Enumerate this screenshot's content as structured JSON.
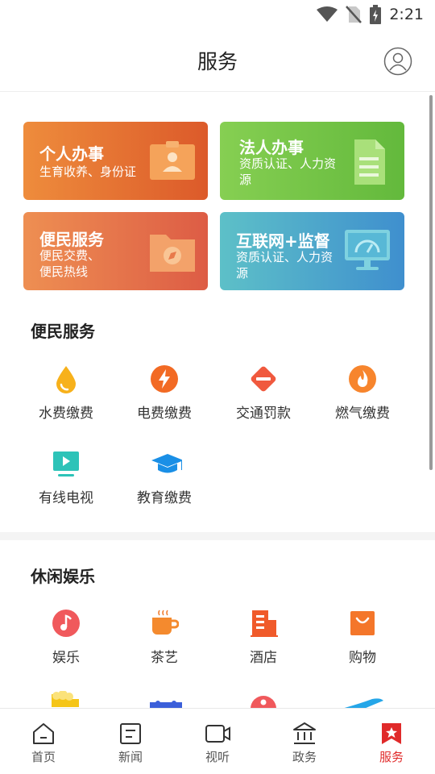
{
  "status_bar": {
    "time": "2:21"
  },
  "header": {
    "title": "服务"
  },
  "cards": [
    {
      "title": "个人办事",
      "subtitle": "生育收养、身份证",
      "icon": "id-card-icon"
    },
    {
      "title": "法人办事",
      "subtitle": "资质认证、人力资源",
      "icon": "document-icon"
    },
    {
      "title": "便民服务",
      "subtitle": "便民交费、便民热线",
      "icon": "folder-compass-icon"
    },
    {
      "title": "互联网+监督",
      "subtitle": "资质认证、人力资源",
      "icon": "monitor-icon"
    }
  ],
  "convenience": {
    "title": "便民服务",
    "items": [
      {
        "label": "水费缴费",
        "icon": "water-drop-icon"
      },
      {
        "label": "电费缴费",
        "icon": "lightning-icon"
      },
      {
        "label": "交通罚款",
        "icon": "traffic-icon"
      },
      {
        "label": "燃气缴费",
        "icon": "flame-icon"
      },
      {
        "label": "有线电视",
        "icon": "tv-icon"
      },
      {
        "label": "教育缴费",
        "icon": "graduation-cap-icon"
      }
    ]
  },
  "leisure": {
    "title": "休闲娱乐",
    "items": [
      {
        "label": "娱乐",
        "icon": "music-icon"
      },
      {
        "label": "茶艺",
        "icon": "tea-cup-icon"
      },
      {
        "label": "酒店",
        "icon": "hotel-icon"
      },
      {
        "label": "购物",
        "icon": "shopping-bag-icon"
      }
    ]
  },
  "tabbar": {
    "items": [
      {
        "label": "首页",
        "icon": "home-icon"
      },
      {
        "label": "新闻",
        "icon": "news-icon"
      },
      {
        "label": "视听",
        "icon": "video-icon"
      },
      {
        "label": "政务",
        "icon": "government-icon"
      },
      {
        "label": "服务",
        "icon": "service-bookmark-icon",
        "active": true
      }
    ]
  },
  "colors": {
    "accent": "#e02a2a"
  }
}
